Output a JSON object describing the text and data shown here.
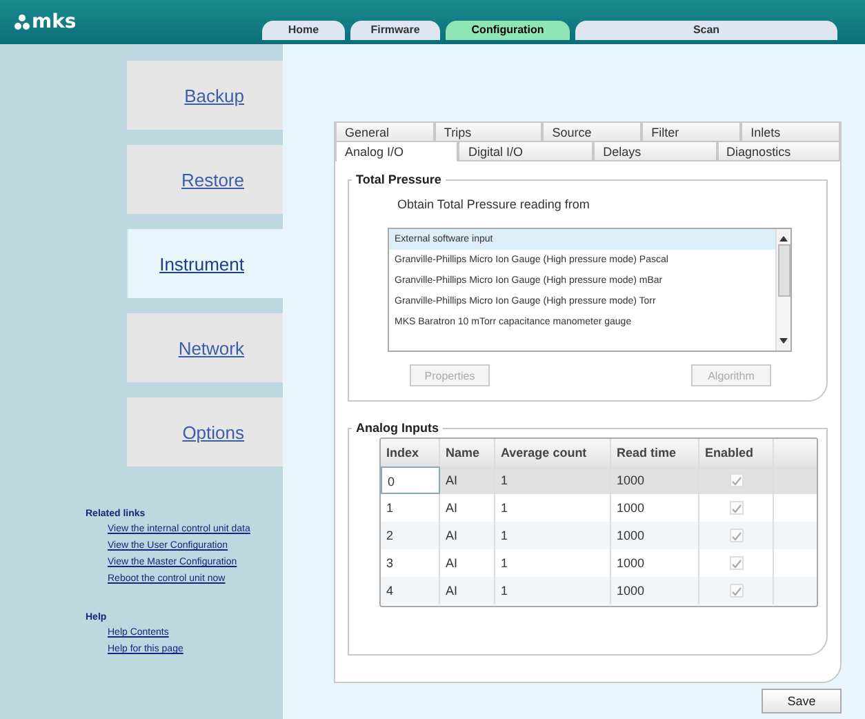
{
  "logo": "mks",
  "nav_tabs": [
    {
      "label": "Home",
      "selected": false
    },
    {
      "label": "Firmware",
      "selected": false
    },
    {
      "label": "Configuration",
      "selected": true
    },
    {
      "label": "Scan",
      "selected": false
    }
  ],
  "sidebar": {
    "items": [
      {
        "label": "Backup",
        "selected": false
      },
      {
        "label": "Restore",
        "selected": false
      },
      {
        "label": "Instrument",
        "selected": true
      },
      {
        "label": "Network",
        "selected": false
      },
      {
        "label": "Options",
        "selected": false
      }
    ],
    "related_links": {
      "title": "Related links",
      "links": [
        "View the internal control unit data",
        "View the User Configuration",
        "View the Master Configuration",
        "Reboot the control unit now"
      ]
    },
    "help": {
      "title": "Help",
      "links": [
        "Help Contents",
        "Help for this page"
      ]
    }
  },
  "tabs_row_1": [
    {
      "label": "General",
      "selected": false
    },
    {
      "label": "Trips",
      "selected": false
    },
    {
      "label": "Source",
      "selected": false
    },
    {
      "label": "Filter",
      "selected": false
    },
    {
      "label": "Inlets",
      "selected": false
    }
  ],
  "tabs_row_2": [
    {
      "label": "Analog I/O",
      "selected": true
    },
    {
      "label": "Digital I/O",
      "selected": false
    },
    {
      "label": "Delays",
      "selected": false
    },
    {
      "label": "Diagnostics",
      "selected": false
    }
  ],
  "total_pressure": {
    "title": "Total Pressure",
    "prompt": "Obtain Total Pressure reading from",
    "options": [
      {
        "label": "External software input",
        "selected": true
      },
      {
        "label": "Granville-Phillips Micro Ion Gauge (High pressure mode) Pascal",
        "selected": false
      },
      {
        "label": "Granville-Phillips Micro Ion Gauge (High pressure mode) mBar",
        "selected": false
      },
      {
        "label": "Granville-Phillips Micro Ion Gauge (High pressure mode) Torr",
        "selected": false
      },
      {
        "label": "MKS Baratron 10 mTorr capacitance manometer gauge",
        "selected": false
      }
    ],
    "buttons": [
      {
        "label": "Properties",
        "disabled": true
      },
      {
        "label": "Algorithm",
        "disabled": true
      }
    ]
  },
  "analog_inputs": {
    "title": "Analog Inputs",
    "columns": [
      "Index",
      "Name",
      "Average count",
      "Read time",
      "Enabled"
    ],
    "rows": [
      {
        "index": "0",
        "name": "AI",
        "average_count": "1",
        "read_time": "1000",
        "enabled": true,
        "selected": true
      },
      {
        "index": "1",
        "name": "AI",
        "average_count": "1",
        "read_time": "1000",
        "enabled": true,
        "selected": false
      },
      {
        "index": "2",
        "name": "AI",
        "average_count": "1",
        "read_time": "1000",
        "enabled": true,
        "selected": false
      },
      {
        "index": "3",
        "name": "AI",
        "average_count": "1",
        "read_time": "1000",
        "enabled": true,
        "selected": false
      },
      {
        "index": "4",
        "name": "AI",
        "average_count": "1",
        "read_time": "1000",
        "enabled": true,
        "selected": false
      }
    ]
  },
  "save_button": "Save"
}
